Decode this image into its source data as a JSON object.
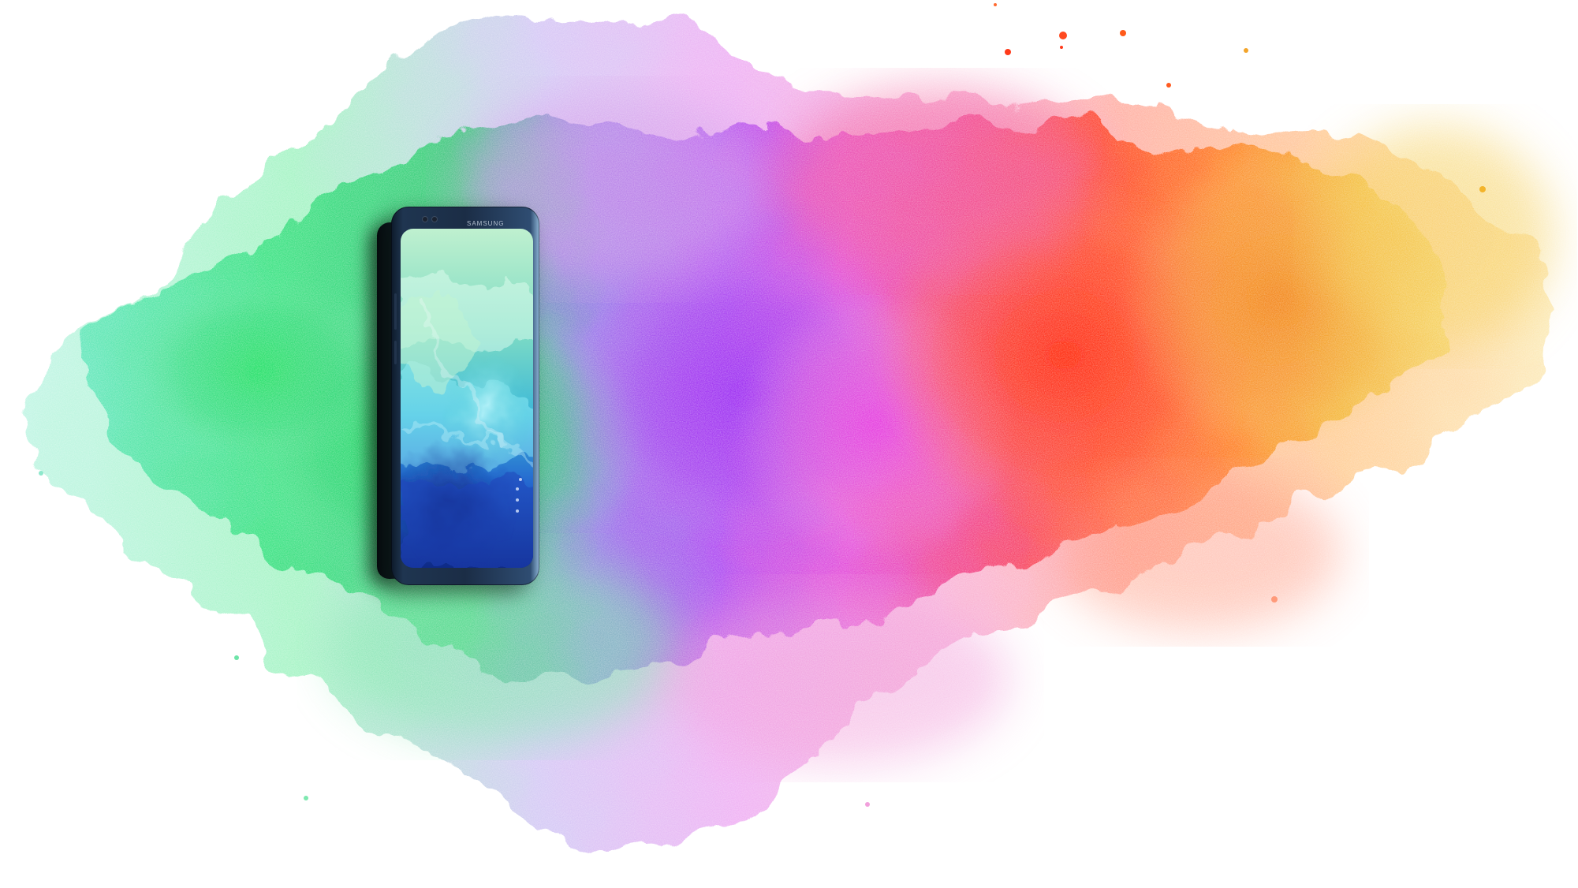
{
  "scene": {
    "description_free": true,
    "background_color": "#ffffff",
    "splash_colors": [
      "#3ee08a",
      "#22c98a",
      "#7b5cf0",
      "#b24ae8",
      "#e24ad0",
      "#f2367a",
      "#ff3a1a",
      "#ff7a18",
      "#f3b42a",
      "#f5d36a"
    ],
    "phone": {
      "brand_label": "SAMSUNG",
      "screen_colors": [
        "#9ee8c8",
        "#4fd1d8",
        "#2f7ad8",
        "#14329a"
      ],
      "body_color": "#1f3550"
    }
  }
}
